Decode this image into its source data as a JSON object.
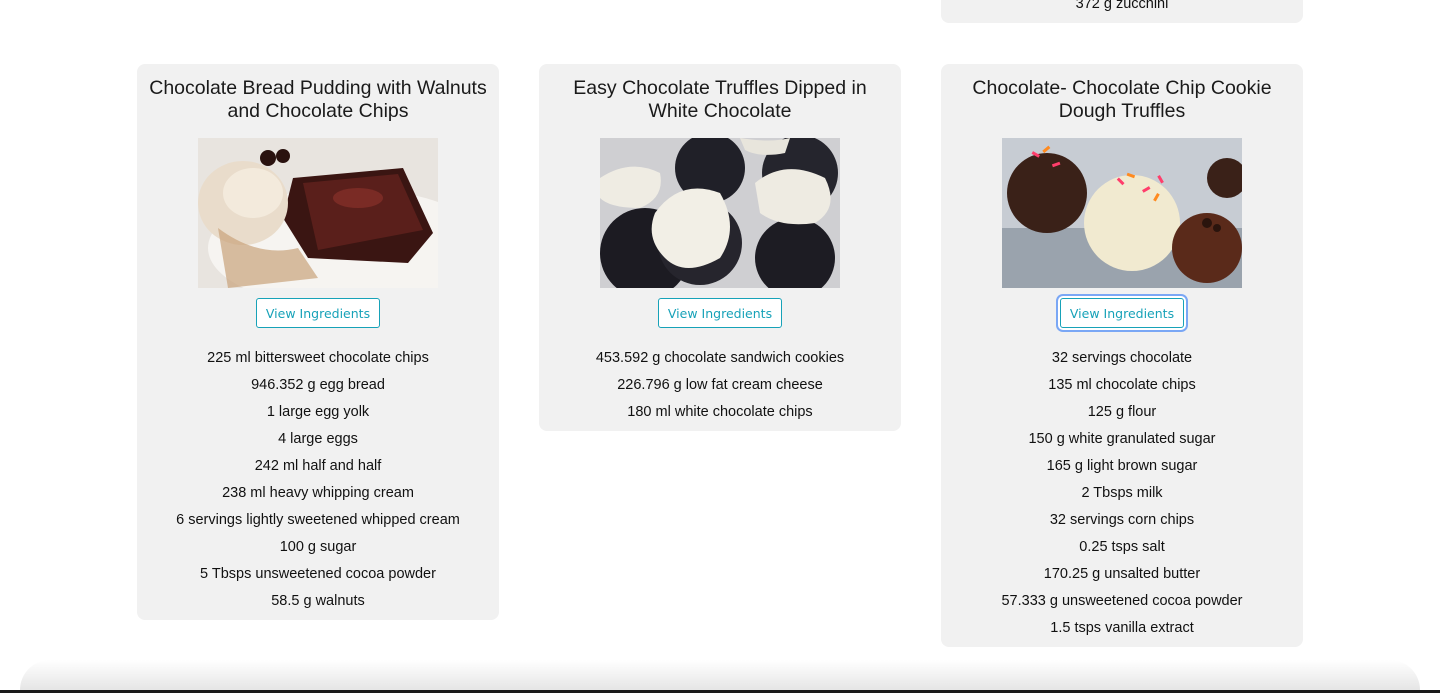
{
  "partial_card": {
    "ingredient": "372 g zucchini"
  },
  "recipes": [
    {
      "title": "Chocolate Bread Pudding with Walnuts and Chocolate Chips",
      "button_label": "View Ingredients",
      "ingredients": [
        "225 ml bittersweet chocolate chips",
        "946.352 g egg bread",
        "1 large egg yolk",
        "4 large eggs",
        "242 ml half and half",
        "238 ml heavy whipping cream",
        "6 servings lightly sweetened whipped cream",
        "100 g sugar",
        "5 Tbsps unsweetened cocoa powder",
        "58.5 g walnuts"
      ]
    },
    {
      "title": "Easy Chocolate Truffles Dipped in White Chocolate",
      "button_label": "View Ingredients",
      "ingredients": [
        "453.592 g chocolate sandwich cookies",
        "226.796 g low fat cream cheese",
        "180 ml white chocolate chips"
      ]
    },
    {
      "title": "Chocolate- Chocolate Chip Cookie Dough Truffles",
      "button_label": "View Ingredients",
      "ingredients": [
        "32 servings chocolate",
        "135 ml chocolate chips",
        "125 g flour",
        "150 g white granulated sugar",
        "165 g light brown sugar",
        "2 Tbsps milk",
        "32 servings corn chips",
        "0.25 tsps salt",
        "170.25 g unsalted butter",
        "57.333 g unsweetened cocoa powder",
        "1.5 tsps vanilla extract"
      ]
    }
  ],
  "colors": {
    "card_bg": "#f1f1f1",
    "button_accent": "#17a2b8",
    "focus_ring": "#7aa7f5"
  }
}
